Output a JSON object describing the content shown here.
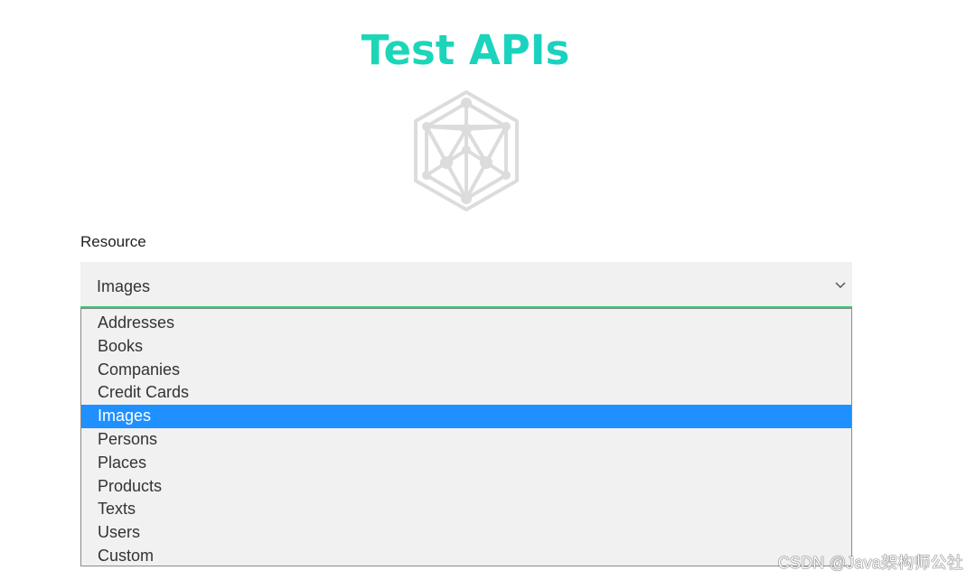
{
  "header": {
    "title": "Test APIs"
  },
  "logo": {
    "icon": "network-cube-logo",
    "color": "#dcdcdc"
  },
  "form": {
    "resource_label": "Resource",
    "resource_select": {
      "value": "Images",
      "options": [
        "Addresses",
        "Books",
        "Companies",
        "Credit Cards",
        "Images",
        "Persons",
        "Places",
        "Products",
        "Texts",
        "Users",
        "Custom"
      ],
      "selected_option": "Images"
    }
  },
  "watermark": "CSDN @Java架构师公社",
  "colors": {
    "title_gradient_start": "#1ee1a1",
    "title_gradient_end": "#18c8d6",
    "select_focus_border": "#2ecc71",
    "option_highlight": "#1e90ff"
  }
}
